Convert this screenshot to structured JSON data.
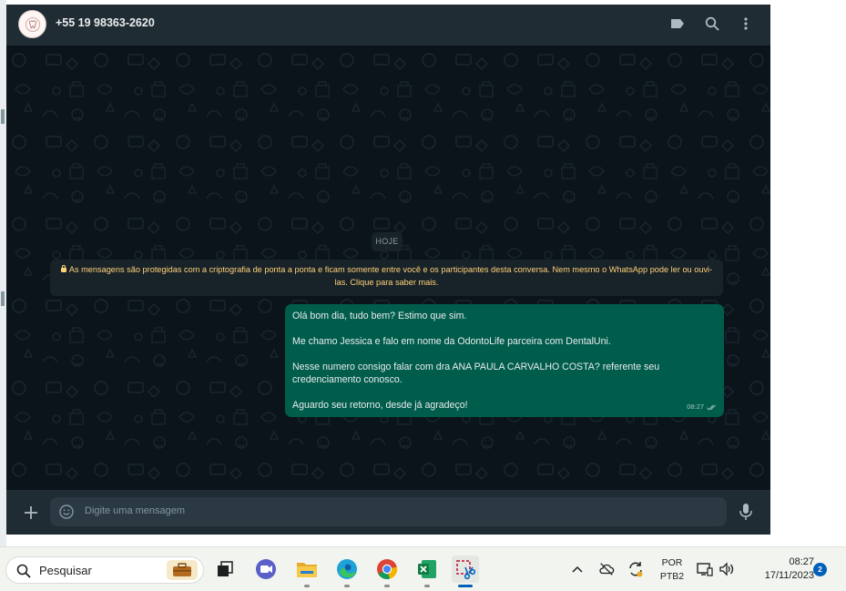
{
  "header": {
    "contact_name": "+55 19 98363-2620"
  },
  "chat": {
    "date_label": "HOJE",
    "encryption_notice": "As mensagens são protegidas com a criptografia de ponta a ponta e ficam somente entre você e os participantes desta conversa. Nem mesmo o WhatsApp pode ler ou ouvi-las. Clique para saber mais.",
    "message": {
      "lines": [
        "Olá bom dia, tudo bem? Estimo que sim.",
        "Me chamo Jessica e falo em nome da OdontoLife parceira com DentalUni.",
        "Nesse numero consigo falar com dra ANA PAULA CARVALHO COSTA? referente seu credenciamento conosco.",
        "Aguardo seu retorno, desde já agradeço!"
      ],
      "time": "08:27"
    }
  },
  "composer": {
    "placeholder": "Digite uma mensagem"
  },
  "taskbar": {
    "search_placeholder": "Pesquisar",
    "language": {
      "line1": "POR",
      "line2": "PTB2"
    },
    "time": "08:27",
    "date": "17/11/2023",
    "notification_count": "2"
  },
  "colors": {
    "header_bg": "#202c33",
    "chat_bg": "#0b141a",
    "outgoing_bubble": "#005c4b",
    "notice_text": "#ffd279",
    "taskbar_accent": "#005fb8"
  }
}
